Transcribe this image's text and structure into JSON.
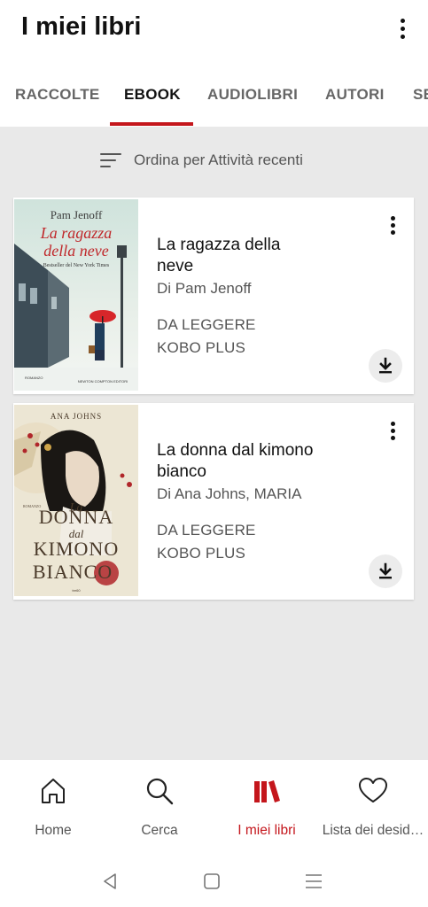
{
  "header": {
    "title": "I miei libri"
  },
  "tabs": [
    {
      "label": "RACCOLTE",
      "active": false
    },
    {
      "label": "EBOOK",
      "active": true
    },
    {
      "label": "AUDIOLIBRI",
      "active": false
    },
    {
      "label": "AUTORI",
      "active": false
    },
    {
      "label": "SE",
      "active": false
    }
  ],
  "sort": {
    "label": "Ordina per Attività recenti"
  },
  "books": [
    {
      "title": "La ragazza della neve",
      "author": "Di Pam Jenoff",
      "status": "DA LEGGERE",
      "subscription": "KOBO PLUS",
      "cover": {
        "author": "Pam Jenoff",
        "title_line1": "La ragazza",
        "title_line2": "della neve",
        "tagline": "Bestseller del New York Times",
        "publisher": "NEWTON COMPTON EDITORI",
        "series": "ROMANZO"
      }
    },
    {
      "title": "La donna dal kimono bianco",
      "author": "Di Ana Johns, MARIA",
      "status": "DA LEGGERE",
      "subscription": "KOBO PLUS",
      "cover": {
        "author": "ANA JOHNS",
        "line1": "La",
        "line2": "DONNA",
        "line3": "dal",
        "line4": "KIMONO",
        "line5": "BIANCO",
        "series": "ROMANZO",
        "publisher": "tre60"
      }
    }
  ],
  "bottom_nav": [
    {
      "label": "Home",
      "icon": "home-icon",
      "active": false
    },
    {
      "label": "Cerca",
      "icon": "search-icon",
      "active": false
    },
    {
      "label": "I miei libri",
      "icon": "library-icon",
      "active": true
    },
    {
      "label": "Lista dei desid…",
      "icon": "heart-icon",
      "active": false
    }
  ],
  "colors": {
    "accent": "#c4161c",
    "background": "#e9e9e9",
    "card": "#ffffff"
  }
}
